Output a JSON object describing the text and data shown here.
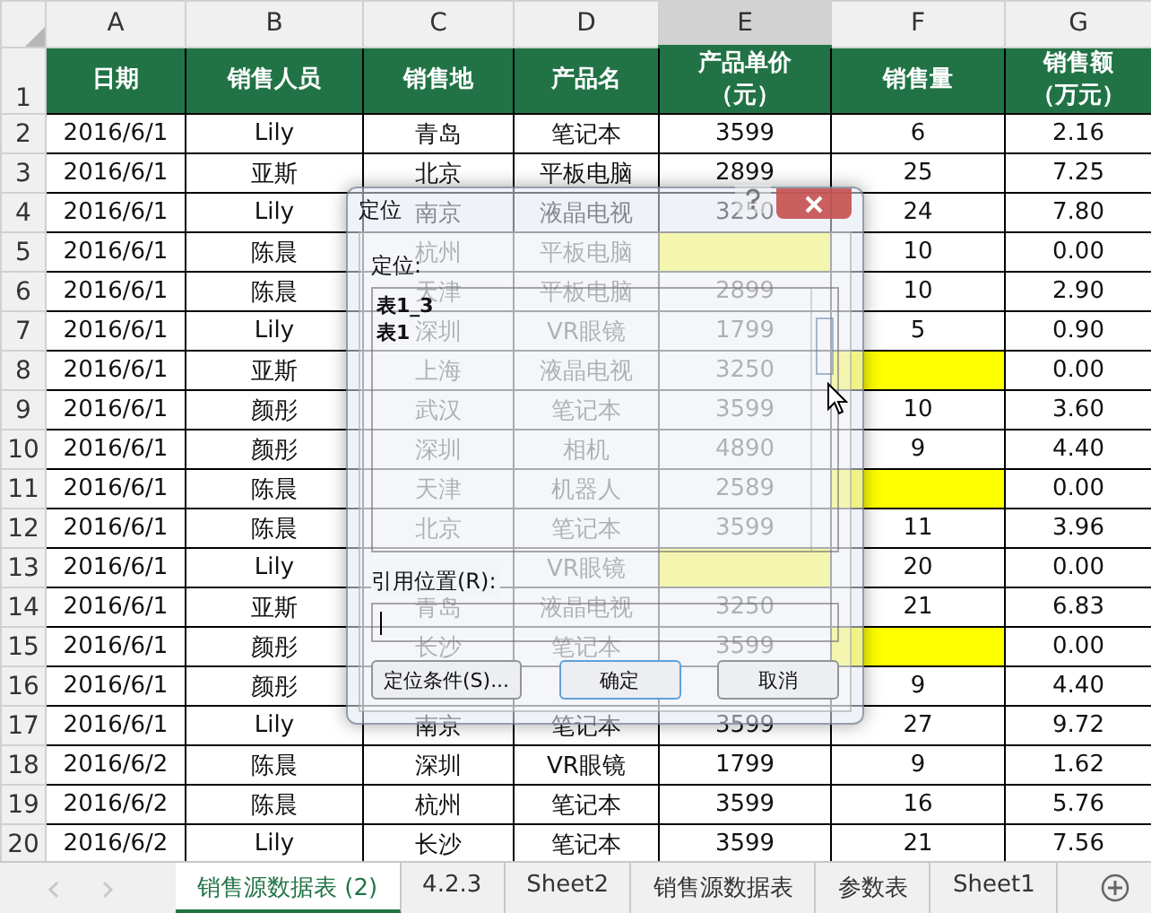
{
  "columns": [
    {
      "label": "A",
      "selected": false
    },
    {
      "label": "B",
      "selected": false
    },
    {
      "label": "C",
      "selected": false
    },
    {
      "label": "D",
      "selected": false
    },
    {
      "label": "E",
      "selected": true
    },
    {
      "label": "F",
      "selected": false
    },
    {
      "label": "G",
      "selected": false
    }
  ],
  "header_row": {
    "num": "1",
    "cells": [
      [
        "日期"
      ],
      [
        "销售人员"
      ],
      [
        "销售地"
      ],
      [
        "产品名"
      ],
      [
        "产品单价",
        "（元）"
      ],
      [
        "销售量"
      ],
      [
        "销售额",
        "（万元）"
      ]
    ]
  },
  "rows": [
    {
      "num": "2",
      "cells": [
        "2016/6/1",
        "Lily",
        "青岛",
        "笔记本",
        "3599",
        "6",
        "2.16"
      ]
    },
    {
      "num": "3",
      "cells": [
        "2016/6/1",
        "亚斯",
        "北京",
        "平板电脑",
        "2899",
        "25",
        "7.25"
      ]
    },
    {
      "num": "4",
      "cells": [
        "2016/6/1",
        "Lily",
        "南京",
        "液晶电视",
        "3250",
        "24",
        "7.80"
      ]
    },
    {
      "num": "5",
      "cells": [
        "2016/6/1",
        "陈晨",
        "杭州",
        "平板电脑",
        {
          "highlighted": true
        },
        "10",
        "0.00"
      ]
    },
    {
      "num": "6",
      "cells": [
        "2016/6/1",
        "陈晨",
        "天津",
        "平板电脑",
        "2899",
        "10",
        "2.90"
      ]
    },
    {
      "num": "7",
      "cells": [
        "2016/6/1",
        "Lily",
        "深圳",
        "VR眼镜",
        "1799",
        "5",
        "0.90"
      ]
    },
    {
      "num": "8",
      "cells": [
        "2016/6/1",
        "亚斯",
        "上海",
        "液晶电视",
        "3250",
        {
          "highlighted": true
        },
        "0.00"
      ]
    },
    {
      "num": "9",
      "cells": [
        "2016/6/1",
        "颜彤",
        "武汉",
        "笔记本",
        "3599",
        "10",
        "3.60"
      ]
    },
    {
      "num": "10",
      "cells": [
        "2016/6/1",
        "颜彤",
        "深圳",
        "相机",
        "4890",
        "9",
        "4.40"
      ]
    },
    {
      "num": "11",
      "cells": [
        "2016/6/1",
        "陈晨",
        "天津",
        "机器人",
        "2589",
        {
          "highlighted": true
        },
        "0.00"
      ]
    },
    {
      "num": "12",
      "cells": [
        "2016/6/1",
        "陈晨",
        "北京",
        "笔记本",
        "3599",
        "11",
        "3.96"
      ]
    },
    {
      "num": "13",
      "cells": [
        "2016/6/1",
        "Lily",
        null,
        "VR眼镜",
        {
          "highlighted": true
        },
        "20",
        "0.00"
      ]
    },
    {
      "num": "14",
      "cells": [
        "2016/6/1",
        "亚斯",
        "青岛",
        "液晶电视",
        "3250",
        "21",
        "6.83"
      ]
    },
    {
      "num": "15",
      "cells": [
        "2016/6/1",
        "颜彤",
        "长沙",
        "笔记本",
        "3599",
        {
          "highlighted": true
        },
        "0.00"
      ]
    },
    {
      "num": "16",
      "cells": [
        "2016/6/1",
        "颜彤",
        null,
        null,
        null,
        "9",
        "4.40"
      ]
    },
    {
      "num": "17",
      "cells": [
        "2016/6/1",
        "Lily",
        "南京",
        "笔记本",
        "3599",
        "27",
        "9.72"
      ]
    },
    {
      "num": "18",
      "cells": [
        "2016/6/2",
        "陈晨",
        "深圳",
        "VR眼镜",
        "1799",
        "9",
        "1.62"
      ]
    },
    {
      "num": "19",
      "cells": [
        "2016/6/2",
        "陈晨",
        "杭州",
        "笔记本",
        "3599",
        "16",
        "5.76"
      ]
    },
    {
      "num": "20",
      "cells": [
        "2016/6/2",
        "Lily",
        "长沙",
        "笔记本",
        "3599",
        "21",
        "7.56"
      ]
    }
  ],
  "dialog": {
    "title": "定位",
    "list_label": "定位:",
    "list_items": [
      {
        "label": "表1_3",
        "selected": false
      },
      {
        "label": "表1",
        "selected": false
      }
    ],
    "reference_label": "引用位置(R):",
    "buttons": [
      {
        "label": "定位条件(S)...",
        "kind": "plain"
      },
      {
        "label": "确定",
        "kind": "default"
      },
      {
        "label": "取消",
        "kind": "plain"
      }
    ]
  },
  "sheet_tabs": [
    {
      "label": "销售源数据表 (2)",
      "selected": true
    },
    {
      "label": "4.2.3",
      "selected": false
    },
    {
      "label": "Sheet2",
      "selected": false
    },
    {
      "label": "销售源数据表",
      "selected": false
    },
    {
      "label": "参数表",
      "selected": false
    },
    {
      "label": "Sheet1",
      "selected": false
    }
  ]
}
